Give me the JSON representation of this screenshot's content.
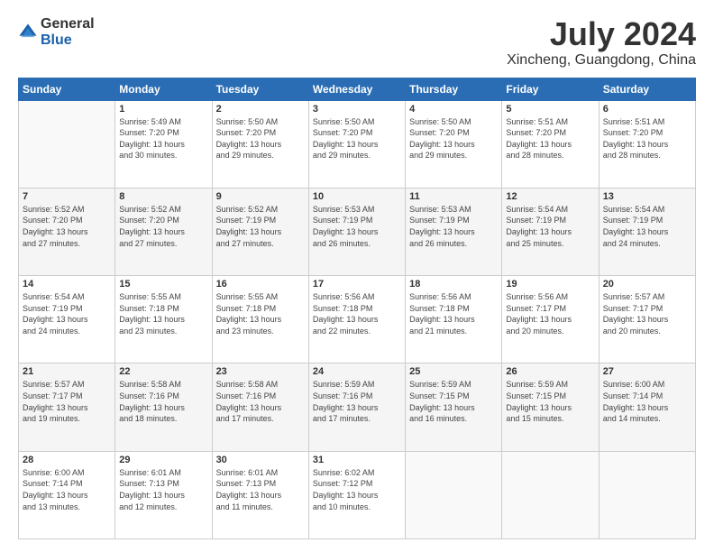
{
  "logo": {
    "general": "General",
    "blue": "Blue"
  },
  "header": {
    "month": "July 2024",
    "location": "Xincheng, Guangdong, China"
  },
  "weekdays": [
    "Sunday",
    "Monday",
    "Tuesday",
    "Wednesday",
    "Thursday",
    "Friday",
    "Saturday"
  ],
  "weeks": [
    [
      {
        "day": "",
        "info": ""
      },
      {
        "day": "1",
        "info": "Sunrise: 5:49 AM\nSunset: 7:20 PM\nDaylight: 13 hours\nand 30 minutes."
      },
      {
        "day": "2",
        "info": "Sunrise: 5:50 AM\nSunset: 7:20 PM\nDaylight: 13 hours\nand 29 minutes."
      },
      {
        "day": "3",
        "info": "Sunrise: 5:50 AM\nSunset: 7:20 PM\nDaylight: 13 hours\nand 29 minutes."
      },
      {
        "day": "4",
        "info": "Sunrise: 5:50 AM\nSunset: 7:20 PM\nDaylight: 13 hours\nand 29 minutes."
      },
      {
        "day": "5",
        "info": "Sunrise: 5:51 AM\nSunset: 7:20 PM\nDaylight: 13 hours\nand 28 minutes."
      },
      {
        "day": "6",
        "info": "Sunrise: 5:51 AM\nSunset: 7:20 PM\nDaylight: 13 hours\nand 28 minutes."
      }
    ],
    [
      {
        "day": "7",
        "info": "Sunrise: 5:52 AM\nSunset: 7:20 PM\nDaylight: 13 hours\nand 27 minutes."
      },
      {
        "day": "8",
        "info": "Sunrise: 5:52 AM\nSunset: 7:20 PM\nDaylight: 13 hours\nand 27 minutes."
      },
      {
        "day": "9",
        "info": "Sunrise: 5:52 AM\nSunset: 7:19 PM\nDaylight: 13 hours\nand 27 minutes."
      },
      {
        "day": "10",
        "info": "Sunrise: 5:53 AM\nSunset: 7:19 PM\nDaylight: 13 hours\nand 26 minutes."
      },
      {
        "day": "11",
        "info": "Sunrise: 5:53 AM\nSunset: 7:19 PM\nDaylight: 13 hours\nand 26 minutes."
      },
      {
        "day": "12",
        "info": "Sunrise: 5:54 AM\nSunset: 7:19 PM\nDaylight: 13 hours\nand 25 minutes."
      },
      {
        "day": "13",
        "info": "Sunrise: 5:54 AM\nSunset: 7:19 PM\nDaylight: 13 hours\nand 24 minutes."
      }
    ],
    [
      {
        "day": "14",
        "info": "Sunrise: 5:54 AM\nSunset: 7:19 PM\nDaylight: 13 hours\nand 24 minutes."
      },
      {
        "day": "15",
        "info": "Sunrise: 5:55 AM\nSunset: 7:18 PM\nDaylight: 13 hours\nand 23 minutes."
      },
      {
        "day": "16",
        "info": "Sunrise: 5:55 AM\nSunset: 7:18 PM\nDaylight: 13 hours\nand 23 minutes."
      },
      {
        "day": "17",
        "info": "Sunrise: 5:56 AM\nSunset: 7:18 PM\nDaylight: 13 hours\nand 22 minutes."
      },
      {
        "day": "18",
        "info": "Sunrise: 5:56 AM\nSunset: 7:18 PM\nDaylight: 13 hours\nand 21 minutes."
      },
      {
        "day": "19",
        "info": "Sunrise: 5:56 AM\nSunset: 7:17 PM\nDaylight: 13 hours\nand 20 minutes."
      },
      {
        "day": "20",
        "info": "Sunrise: 5:57 AM\nSunset: 7:17 PM\nDaylight: 13 hours\nand 20 minutes."
      }
    ],
    [
      {
        "day": "21",
        "info": "Sunrise: 5:57 AM\nSunset: 7:17 PM\nDaylight: 13 hours\nand 19 minutes."
      },
      {
        "day": "22",
        "info": "Sunrise: 5:58 AM\nSunset: 7:16 PM\nDaylight: 13 hours\nand 18 minutes."
      },
      {
        "day": "23",
        "info": "Sunrise: 5:58 AM\nSunset: 7:16 PM\nDaylight: 13 hours\nand 17 minutes."
      },
      {
        "day": "24",
        "info": "Sunrise: 5:59 AM\nSunset: 7:16 PM\nDaylight: 13 hours\nand 17 minutes."
      },
      {
        "day": "25",
        "info": "Sunrise: 5:59 AM\nSunset: 7:15 PM\nDaylight: 13 hours\nand 16 minutes."
      },
      {
        "day": "26",
        "info": "Sunrise: 5:59 AM\nSunset: 7:15 PM\nDaylight: 13 hours\nand 15 minutes."
      },
      {
        "day": "27",
        "info": "Sunrise: 6:00 AM\nSunset: 7:14 PM\nDaylight: 13 hours\nand 14 minutes."
      }
    ],
    [
      {
        "day": "28",
        "info": "Sunrise: 6:00 AM\nSunset: 7:14 PM\nDaylight: 13 hours\nand 13 minutes."
      },
      {
        "day": "29",
        "info": "Sunrise: 6:01 AM\nSunset: 7:13 PM\nDaylight: 13 hours\nand 12 minutes."
      },
      {
        "day": "30",
        "info": "Sunrise: 6:01 AM\nSunset: 7:13 PM\nDaylight: 13 hours\nand 11 minutes."
      },
      {
        "day": "31",
        "info": "Sunrise: 6:02 AM\nSunset: 7:12 PM\nDaylight: 13 hours\nand 10 minutes."
      },
      {
        "day": "",
        "info": ""
      },
      {
        "day": "",
        "info": ""
      },
      {
        "day": "",
        "info": ""
      }
    ]
  ]
}
